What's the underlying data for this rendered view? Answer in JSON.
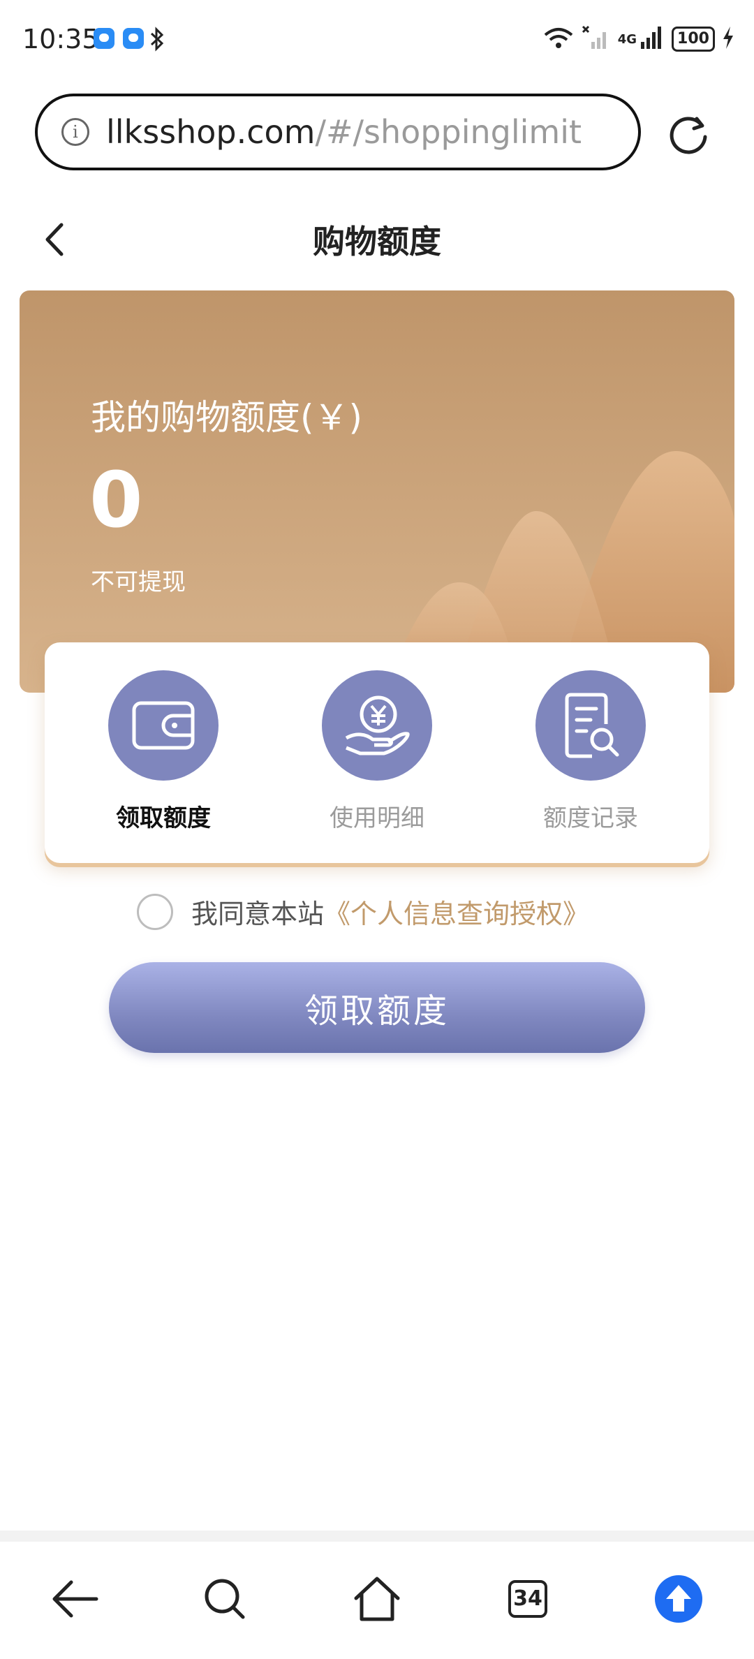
{
  "status_bar": {
    "time": "10:35",
    "network": "4G",
    "battery": "100"
  },
  "browser": {
    "url_domain": "llksshop.com",
    "url_path": "/#/shoppinglimit",
    "tab_count": "34"
  },
  "header": {
    "title": "购物额度"
  },
  "banner": {
    "label": "我的购物额度(￥)",
    "amount": "0",
    "note": "不可提现"
  },
  "actions": [
    {
      "label": "领取额度",
      "icon": "wallet-icon",
      "active": true
    },
    {
      "label": "使用明细",
      "icon": "yuan-hand-icon",
      "active": false
    },
    {
      "label": "额度记录",
      "icon": "document-search-icon",
      "active": false
    }
  ],
  "agreement": {
    "text": "我同意本站",
    "link": "《个人信息查询授权》",
    "checked": false
  },
  "claim_button": {
    "label": "领取额度"
  },
  "colors": {
    "banner_top": "#bf956a",
    "banner_bottom": "#d7b38c",
    "icon_circle": "#7f86bd",
    "link": "#c19a6b",
    "button_top": "#aab2e6",
    "button_bottom": "#6a73ad"
  }
}
